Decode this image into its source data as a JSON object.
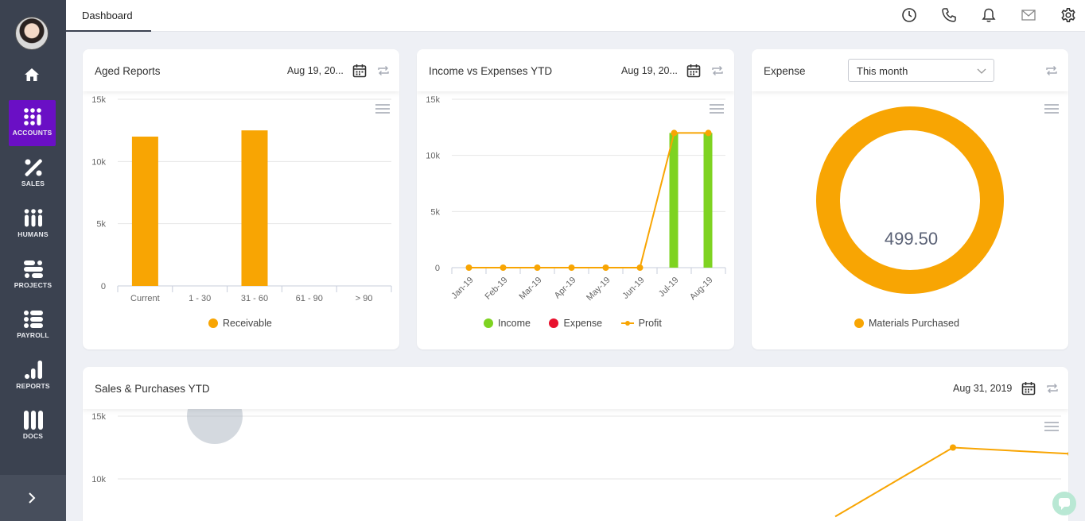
{
  "sidebar": {
    "items": [
      {
        "label": "ACCOUNTS",
        "icon": "grid-dots-icon",
        "active": true
      },
      {
        "label": "SALES",
        "icon": "percent-icon"
      },
      {
        "label": "HUMANS",
        "icon": "people-icon"
      },
      {
        "label": "PROJECTS",
        "icon": "projects-icon"
      },
      {
        "label": "PAYROLL",
        "icon": "payroll-icon"
      },
      {
        "label": "REPORTS",
        "icon": "bar-chart-icon"
      },
      {
        "label": "DOCS",
        "icon": "docs-icon"
      }
    ]
  },
  "topbar": {
    "tab_label": "Dashboard",
    "icons": [
      "clock-icon",
      "phone-icon",
      "bell-icon",
      "mail-icon",
      "gear-icon"
    ]
  },
  "colors": {
    "accent": "#6a0fc5",
    "orange": "#f8a503",
    "green": "#7ed321",
    "red": "#e8112d",
    "sidebar": "#3b4250"
  },
  "aged_reports": {
    "title": "Aged Reports",
    "date": "Aug 19, 20...",
    "legend": "Receivable",
    "chart_data": {
      "type": "bar",
      "categories": [
        "Current",
        "1 - 30",
        "31 - 60",
        "61 - 90",
        "> 90"
      ],
      "series": [
        {
          "name": "Receivable",
          "values": [
            12000,
            0,
            12500,
            0,
            0
          ]
        }
      ],
      "ylim": [
        0,
        15000
      ],
      "yticks": [
        "0",
        "5k",
        "10k",
        "15k"
      ]
    }
  },
  "income_expenses": {
    "title": "Income vs Expenses YTD",
    "date": "Aug 19, 20...",
    "legend": [
      "Income",
      "Expense",
      "Profit"
    ],
    "chart_data": {
      "type": "bar",
      "categories": [
        "Jan-19",
        "Feb-19",
        "Mar-19",
        "Apr-19",
        "May-19",
        "Jun-19",
        "Jul-19",
        "Aug-19"
      ],
      "series": [
        {
          "name": "Income",
          "values": [
            0,
            0,
            0,
            0,
            0,
            0,
            12000,
            12000
          ]
        },
        {
          "name": "Expense",
          "values": [
            0,
            0,
            0,
            0,
            0,
            0,
            0,
            0
          ]
        },
        {
          "name": "Profit",
          "values": [
            0,
            0,
            0,
            0,
            0,
            0,
            12000,
            12000
          ]
        }
      ],
      "ylim": [
        0,
        15000
      ],
      "yticks": [
        "0",
        "5k",
        "10k",
        "15k"
      ]
    }
  },
  "expense": {
    "title": "Expense",
    "select_value": "This month",
    "total": "499.50",
    "legend": "Materials Purchased",
    "chart_data": {
      "type": "pie",
      "slices": [
        {
          "label": "Materials Purchased",
          "value": 499.5
        }
      ]
    }
  },
  "sales_purchases": {
    "title": "Sales & Purchases YTD",
    "date": "Aug 31, 2019",
    "chart_data": {
      "type": "line",
      "yticks": [
        "10k",
        "15k"
      ],
      "ylim": [
        0,
        15000
      ],
      "series": [
        {
          "values": [
            null,
            null,
            null,
            null,
            null,
            null,
            7000,
            12500,
            12000
          ]
        }
      ]
    }
  }
}
